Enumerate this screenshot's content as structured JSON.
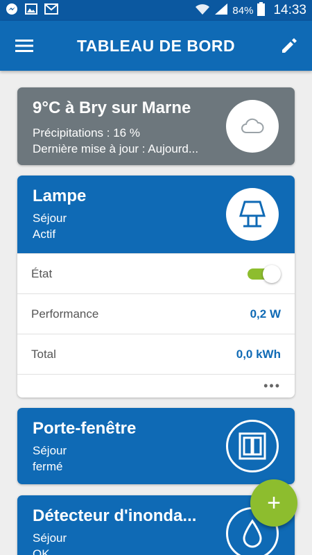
{
  "status_bar": {
    "battery": "84%",
    "time": "14:33",
    "icons": [
      "messenger-icon",
      "gallery-icon",
      "gmail-icon",
      "wifi-icon",
      "signal-icon",
      "battery-icon"
    ]
  },
  "app_bar": {
    "title": "TABLEAU DE BORD",
    "menu_icon": "menu-icon",
    "edit_icon": "pencil-icon"
  },
  "weather": {
    "title": "9°C à Bry sur Marne",
    "precipitation": "Précipitations : 16 %",
    "updated": "Dernière mise à jour : Aujourd...",
    "icon": "cloud-icon"
  },
  "lamp": {
    "title": "Lampe",
    "room": "Séjour",
    "status": "Actif",
    "icon": "lamp-icon",
    "rows": {
      "state_label": "État",
      "state_on": true,
      "performance_label": "Performance",
      "performance_value": "0,2 W",
      "total_label": "Total",
      "total_value": "0,0 kWh"
    },
    "more": "•••"
  },
  "door": {
    "title": "Porte-fenêtre",
    "room": "Séjour",
    "status": "fermé",
    "icon": "window-icon"
  },
  "flood": {
    "title": "Détecteur d'inonda...",
    "room": "Séjour",
    "status": "OK",
    "icon": "water-drop-icon"
  },
  "fab": {
    "label": "+",
    "icon": "plus-icon"
  },
  "colors": {
    "primary": "#0f6ab5",
    "status_bar": "#0b58a0",
    "accent": "#8dbd2e",
    "weather_card": "#6d777d",
    "background": "#eeeeee"
  }
}
